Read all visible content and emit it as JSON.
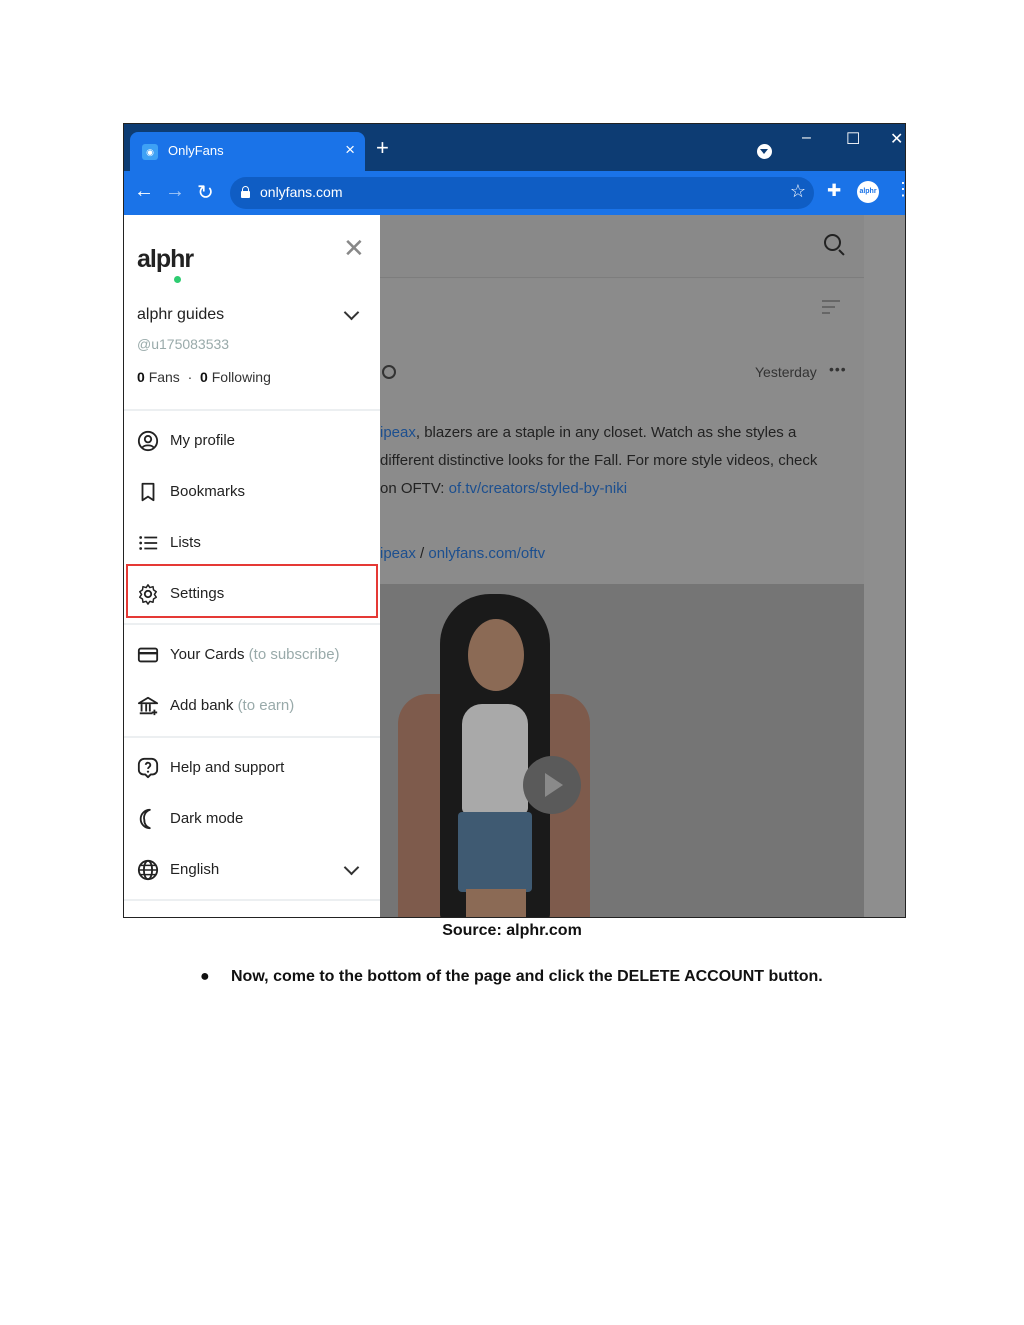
{
  "browser": {
    "tab_title": "OnlyFans",
    "url": "onlyfans.com",
    "avatar_label": "alphr"
  },
  "drawer": {
    "logo": "alphr",
    "display_name": "alphr guides",
    "username": "@u175083533",
    "fans_count": "0",
    "fans_label": "Fans",
    "following_count": "0",
    "following_label": "Following",
    "items": [
      {
        "label": "My profile",
        "icon": "user-circle-icon"
      },
      {
        "label": "Bookmarks",
        "icon": "bookmark-icon"
      },
      {
        "label": "Lists",
        "icon": "list-icon"
      },
      {
        "label": "Settings",
        "icon": "gear-icon"
      },
      {
        "label": "Your Cards",
        "hint": "(to subscribe)",
        "icon": "credit-card-icon"
      },
      {
        "label": "Add bank",
        "hint": "(to earn)",
        "icon": "bank-icon"
      },
      {
        "label": "Help and support",
        "icon": "help-icon"
      },
      {
        "label": "Dark mode",
        "icon": "moon-icon"
      },
      {
        "label": "English",
        "icon": "globe-icon"
      }
    ],
    "highlight_color": "#e53935"
  },
  "post": {
    "timestamp": "Yesterday",
    "caption_link_start": "ipeax",
    "caption_text_1": ", blazers are a staple in any closet. Watch as she styles a",
    "caption_text_2": "different distinctive looks for the Fall. For more style videos, check",
    "caption_text_3": "on OFTV: ",
    "caption_link": "of.tv/creators/styled-by-niki",
    "link_1": "ipeax",
    "link_sep": " / ",
    "link_2": "onlyfans.com/oftv"
  },
  "doc": {
    "source": "Source: alphr.com",
    "bullet": "●",
    "instruction": "Now, come to the bottom of the page and click the DELETE ACCOUNT button."
  }
}
